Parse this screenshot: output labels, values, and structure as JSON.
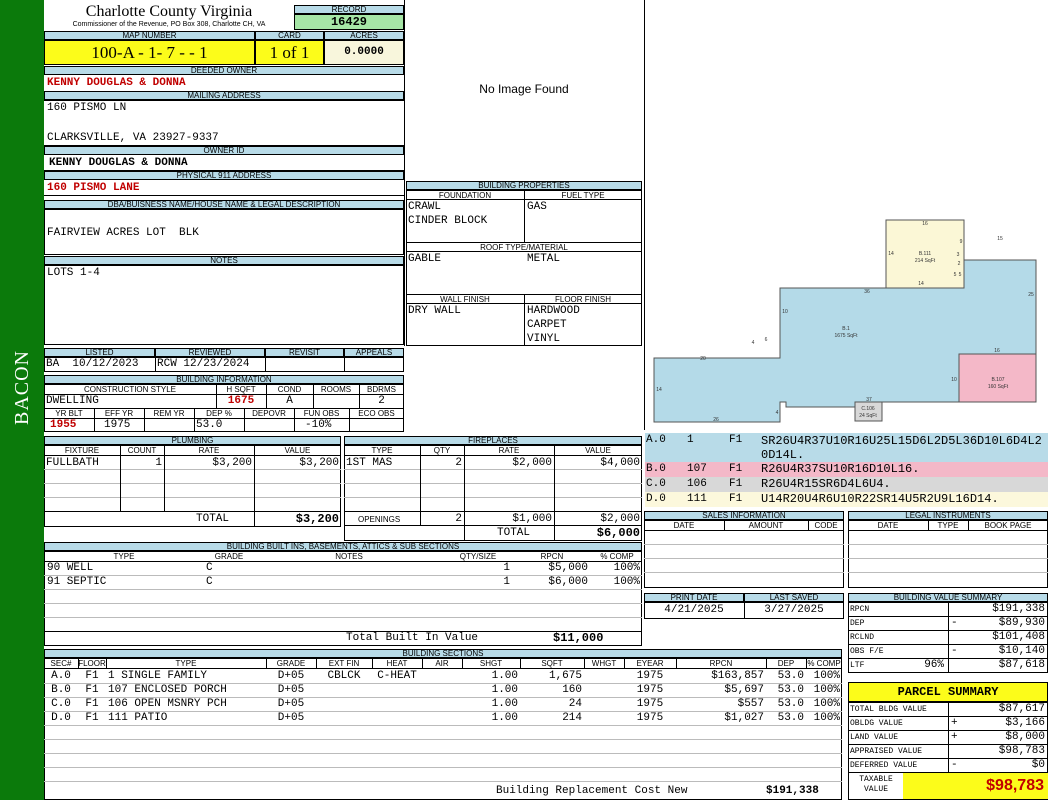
{
  "side_label": "BACON",
  "county": {
    "name": "Charlotte County Virginia",
    "address": "Commissioner of the Revenue, PO Box 308, Charlotte CH, VA"
  },
  "record": {
    "label": "RECORD",
    "value": "16429"
  },
  "map": {
    "label": "MAP NUMBER",
    "value": "100-A - 1- 7 -  -  1"
  },
  "card": {
    "label": "CARD",
    "value": "1 of 1"
  },
  "acres": {
    "label": "ACRES",
    "value": "0.0000"
  },
  "deeded_owner": {
    "label": "DEEDED OWNER",
    "value": "KENNY DOUGLAS & DONNA"
  },
  "mailing": {
    "label": "MAILING ADDRESS",
    "line1": "160 PISMO LN",
    "line2": "CLARKSVILLE, VA 23927-9337"
  },
  "owner_id": {
    "label": "OWNER ID",
    "value": "KENNY DOUGLAS & DONNA"
  },
  "physical": {
    "label": "PHYSICAL 911 ADDRESS",
    "value": "160 PISMO LANE"
  },
  "dba": {
    "label": "DBA/BUISNESS NAME/HOUSE NAME & LEGAL DESCRIPTION",
    "value": "FAIRVIEW ACRES LOT  BLK"
  },
  "notes": {
    "label": "NOTES",
    "value": "LOTS 1-4"
  },
  "image": {
    "text": "No Image Found"
  },
  "building_props": {
    "label": "BUILDING PROPERTIES",
    "foundation_label": "FOUNDATION",
    "foundation": [
      "CRAWL",
      "CINDER BLOCK"
    ],
    "fuel_label": "FUEL TYPE",
    "fuel": [
      "GAS"
    ],
    "roof_label": "ROOF TYPE/MATERIAL",
    "roof_type": "GABLE",
    "roof_material": "METAL",
    "wall_label": "WALL FINISH",
    "wall": [
      "DRY WALL"
    ],
    "floor_label": "FLOOR FINISH",
    "floor": [
      "HARDWOOD",
      "CARPET",
      "VINYL"
    ]
  },
  "status": {
    "headers": [
      "LISTED",
      "REVIEWED",
      "REVISIT",
      "APPEALS"
    ],
    "listed": "BA  10/12/2023",
    "reviewed": "RCW 12/23/2024",
    "revisit": "",
    "appeals": ""
  },
  "building_info": {
    "label": "BUILDING INFORMATION",
    "h1": [
      "CONSTRUCTION STYLE",
      "H SQFT",
      "COND",
      "ROOMS",
      "BDRMS"
    ],
    "v1": [
      "DWELLING",
      "1675",
      "A",
      "",
      "2"
    ],
    "h2": [
      "YR BLT",
      "EFF YR",
      "REM YR",
      "DEP %",
      "DEPOVR",
      "FUN OBS",
      "ECO OBS"
    ],
    "v2": [
      "1955",
      "1975",
      "",
      "53.0",
      "",
      "-10%",
      ""
    ]
  },
  "plumbing": {
    "label": "PLUMBING",
    "headers": [
      "FIXTURE",
      "COUNT",
      "RATE",
      "VALUE"
    ],
    "rows": [
      [
        "FULLBATH",
        "1",
        "$3,200",
        "$3,200"
      ]
    ],
    "total_label": "TOTAL",
    "total": "$3,200"
  },
  "fireplaces": {
    "label": "FIREPLACES",
    "headers": [
      "TYPE",
      "QTY",
      "RATE",
      "VALUE"
    ],
    "rows": [
      [
        "1ST MAS",
        "2",
        "$2,000",
        "$4,000"
      ]
    ],
    "openings_label": "OPENINGS",
    "openings": [
      "2",
      "$1,000",
      "$2,000"
    ],
    "total_label": "TOTAL",
    "total": "$6,000"
  },
  "builtins": {
    "label": "BUILDING BUILT INS, BASEMENTS, ATTICS & SUB SECTIONS",
    "headers": [
      "TYPE",
      "GRADE",
      "NOTES",
      "QTY/SIZE",
      "RPCN",
      "% COMP"
    ],
    "rows": [
      [
        "90 WELL",
        "C",
        "",
        "1",
        "$5,000",
        "100%"
      ],
      [
        "91 SEPTIC",
        "C",
        "",
        "1",
        "$6,000",
        "100%"
      ]
    ],
    "total_label": "Total Built In Value",
    "total": "$11,000"
  },
  "sections": {
    "label": "BUILDING SECTIONS",
    "headers": [
      "SEC#",
      "FLOOR",
      "TYPE",
      "GRADE",
      "EXT FIN",
      "HEAT",
      "AIR",
      "SHGT",
      "SQFT",
      "WHGT",
      "EYEAR",
      "RPCN",
      "DEP",
      "% COMP"
    ],
    "rows": [
      [
        "A.0",
        "F1",
        "1 SINGLE FAMILY",
        "D+05",
        "CBLCK",
        "C-HEAT",
        "",
        "1.00",
        "1,675",
        "",
        "1975",
        "$163,857",
        "53.0",
        "100%"
      ],
      [
        "B.0",
        "F1",
        "107 ENCLOSED PORCH",
        "D+05",
        "",
        "",
        "",
        "1.00",
        "160",
        "",
        "1975",
        "$5,697",
        "53.0",
        "100%"
      ],
      [
        "C.0",
        "F1",
        "106 OPEN MSNRY PCH",
        "D+05",
        "",
        "",
        "",
        "1.00",
        "24",
        "",
        "1975",
        "$557",
        "53.0",
        "100%"
      ],
      [
        "D.0",
        "F1",
        "111 PATIO",
        "D+05",
        "",
        "",
        "",
        "1.00",
        "214",
        "",
        "1975",
        "$1,027",
        "53.0",
        "100%"
      ]
    ],
    "total_label": "Building Replacement Cost New",
    "total": "$191,338"
  },
  "sketch": {
    "areas": [
      {
        "label": "B.1",
        "sqft": "1675 SqFt"
      },
      {
        "label": "B.111",
        "sqft": "214 SqFt"
      },
      {
        "label": "B.107",
        "sqft": "160 SqFt"
      },
      {
        "label": "C.106",
        "sqft": "24 SqFt"
      }
    ],
    "dims": [
      "16",
      "9",
      "15",
      "14",
      "3",
      "2",
      "5",
      "5",
      "14",
      "36",
      "25",
      "10",
      "4",
      "6",
      "20",
      "16",
      "10",
      "14",
      "26",
      "4",
      "37"
    ]
  },
  "vectors": [
    {
      "sec": "A.0",
      "num": "1",
      "fl": "F1",
      "code": "SR26U4R37U10R16U25L15D6L2D5L36D10L6D4L20D14L.",
      "color": "#b8dbe8"
    },
    {
      "sec": "B.0",
      "num": "107",
      "fl": "F1",
      "code": "R26U4R37SU10R16D10L16.",
      "color": "#f4b8c8"
    },
    {
      "sec": "C.0",
      "num": "106",
      "fl": "F1",
      "code": "R26U4R15SR6D4L6U4.",
      "color": "#d8d8d8"
    },
    {
      "sec": "D.0",
      "num": "111",
      "fl": "F1",
      "code": "U14R20U4R6U10R22SR14U5R2U9L16D14.",
      "color": "#fcf8dc"
    }
  ],
  "sales": {
    "label": "SALES INFORMATION",
    "headers": [
      "DATE",
      "AMOUNT",
      "CODE"
    ]
  },
  "legal": {
    "label": "LEGAL INSTRUMENTS",
    "headers": [
      "DATE",
      "TYPE",
      "BOOK PAGE"
    ]
  },
  "dates": {
    "print_label": "PRINT DATE",
    "print": "4/21/2025",
    "saved_label": "LAST SAVED",
    "saved": "3/27/2025"
  },
  "value_summary": {
    "label": "BUILDING VALUE SUMMARY",
    "rows": [
      [
        "RPCN",
        "",
        "",
        "$191,338"
      ],
      [
        "DEP",
        "",
        "-",
        "$89,930"
      ],
      [
        "RCLND",
        "",
        "",
        "$101,408"
      ],
      [
        "OBS F/E",
        "",
        "-",
        "$10,140"
      ],
      [
        "LTF",
        "96%",
        "",
        "$87,618"
      ]
    ]
  },
  "parcel": {
    "label": "PARCEL SUMMARY",
    "rows": [
      [
        "TOTAL BLDG VALUE",
        "",
        "$87,617"
      ],
      [
        "OBLDG VALUE",
        "+",
        "$3,166"
      ],
      [
        "LAND VALUE",
        "+",
        "$8,000"
      ],
      [
        "APPRAISED VALUE",
        "",
        "$98,783"
      ],
      [
        "DEFERRED VALUE",
        "-",
        "$0"
      ]
    ],
    "taxable_label": "TAXABLE VALUE",
    "taxable": "$98,783"
  }
}
